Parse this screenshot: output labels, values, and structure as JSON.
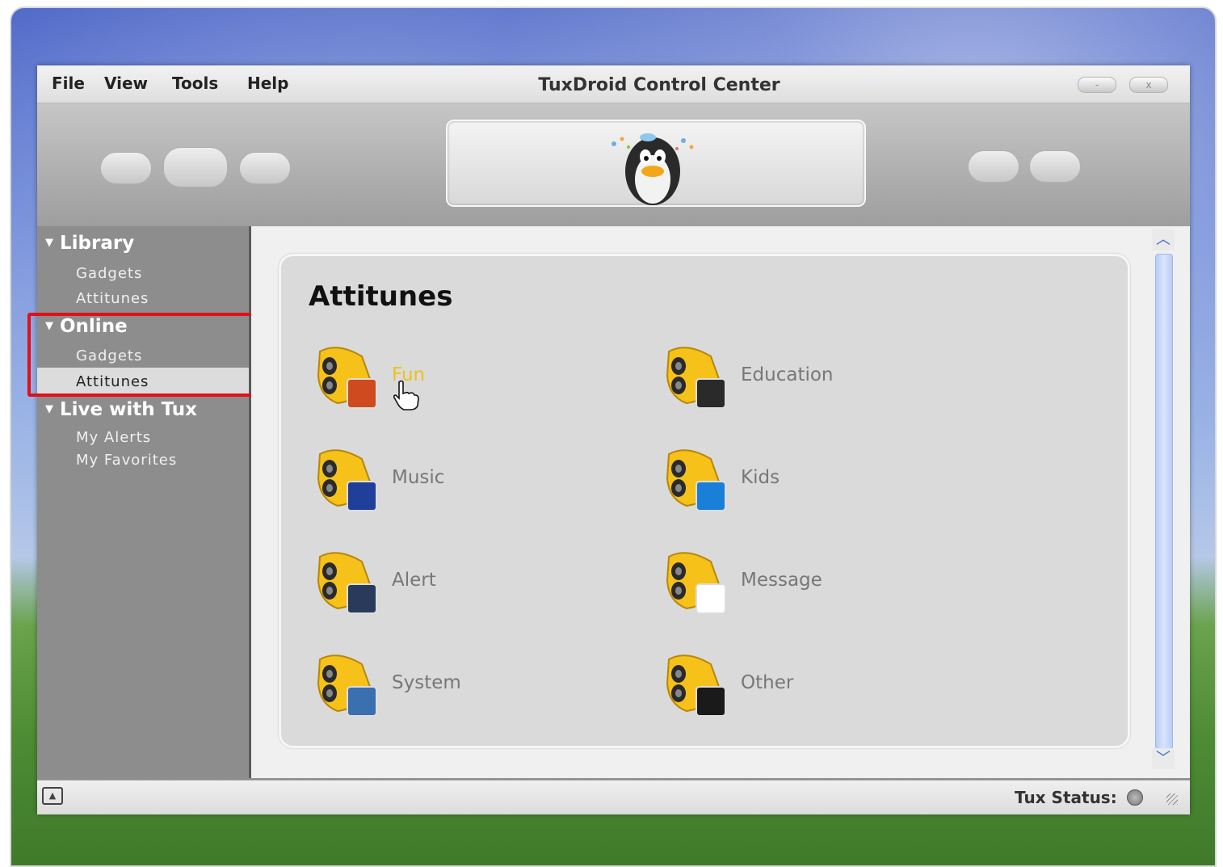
{
  "window": {
    "title": "TuxDroid Control Center",
    "minimize_label": "-",
    "close_label": "x"
  },
  "menu": [
    "File",
    "View",
    "Tools",
    "Help"
  ],
  "sidebar": {
    "sections": [
      {
        "label": "Library",
        "items": [
          "Gadgets",
          "Attitunes"
        ]
      },
      {
        "label": "Online",
        "items": [
          "Gadgets",
          "Attitunes"
        ]
      },
      {
        "label": "Live with Tux",
        "items": [
          "My Alerts",
          "My Favorites"
        ]
      }
    ],
    "selected": "Online > Attitunes"
  },
  "main": {
    "title": "Attitunes",
    "categories": [
      {
        "label": "Fun",
        "icon": "fun-icon",
        "hovered": true
      },
      {
        "label": "Education",
        "icon": "education-icon"
      },
      {
        "label": "Music",
        "icon": "music-icon"
      },
      {
        "label": "Kids",
        "icon": "kids-icon"
      },
      {
        "label": "Alert",
        "icon": "alert-icon"
      },
      {
        "label": "Message",
        "icon": "message-icon"
      },
      {
        "label": "System",
        "icon": "system-icon"
      },
      {
        "label": "Other",
        "icon": "other-icon"
      }
    ]
  },
  "status": {
    "label": "Tux Status:"
  },
  "colors": {
    "highlight_box": "#e0101a",
    "hover_text": "#f0c020",
    "scrollbar": "#b9cdf5"
  }
}
